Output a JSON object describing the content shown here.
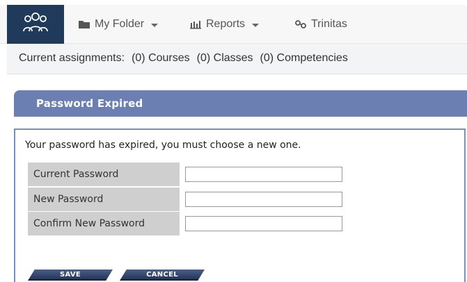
{
  "nav": {
    "items": [
      {
        "label": "My Folder",
        "icon": "folder-icon"
      },
      {
        "label": "Reports",
        "icon": "bar-chart-icon"
      },
      {
        "label": "Trinitas",
        "icon": "link-icon"
      }
    ],
    "logo_icon": "group-icon"
  },
  "assignments": {
    "label": "Current assignments:",
    "courses": "(0) Courses",
    "classes": "(0) Classes",
    "competencies": "(0) Competencies"
  },
  "password_panel": {
    "title": "Password Expired",
    "message": "Your password has expired, you must choose a new one.",
    "fields": [
      {
        "label": "Current Password",
        "value": ""
      },
      {
        "label": "New Password",
        "value": ""
      },
      {
        "label": "Confirm New Password",
        "value": ""
      }
    ]
  },
  "actions": {
    "save_label": "SAVE",
    "cancel_label": "CANCEL"
  },
  "colors": {
    "logo_bg": "#1f3a5a",
    "header_bg": "#6c7fb2",
    "button_bg": "#2f4165"
  }
}
